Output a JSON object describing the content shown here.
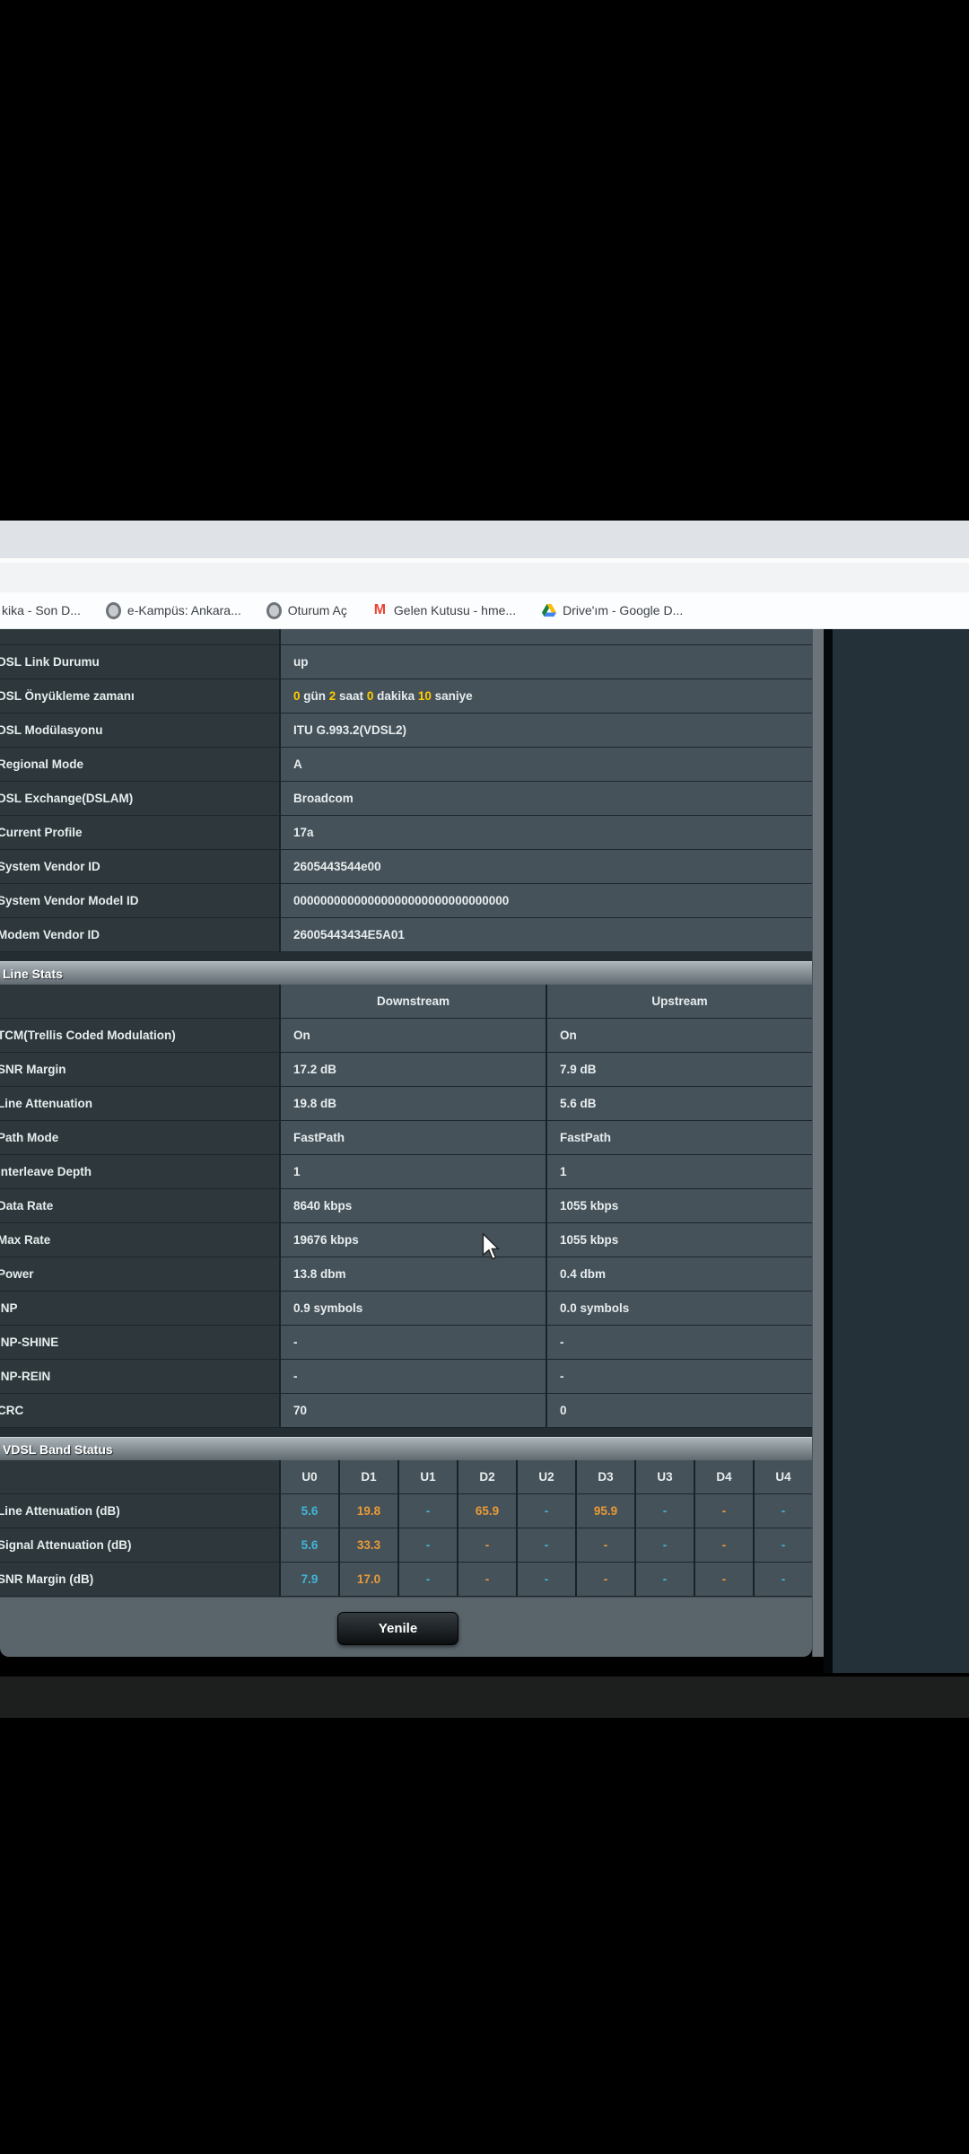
{
  "browser": {
    "bookmarks": [
      {
        "label": "kika - Son D...",
        "icon": "none"
      },
      {
        "label": "e-Kampüs: Ankara...",
        "icon": "globe"
      },
      {
        "label": "Oturum Aç",
        "icon": "globe"
      },
      {
        "label": "Gelen Kutusu - hme...",
        "icon": "gmail"
      },
      {
        "label": "Drive'ım - Google D...",
        "icon": "drive"
      }
    ]
  },
  "dsl_table": {
    "rows": [
      {
        "label": "DSL Link Durumu",
        "value": "up"
      },
      {
        "label": "DSL Önyükleme zamanı",
        "segments": [
          {
            "t": "0",
            "h": true
          },
          {
            "t": " gün ",
            "h": false
          },
          {
            "t": "2",
            "h": true
          },
          {
            "t": " saat ",
            "h": false
          },
          {
            "t": "0",
            "h": true
          },
          {
            "t": " dakika ",
            "h": false
          },
          {
            "t": "10",
            "h": true
          },
          {
            "t": " saniye",
            "h": false
          }
        ]
      },
      {
        "label": "DSL Modülasyonu",
        "value": "ITU G.993.2(VDSL2)"
      },
      {
        "label": "Regional Mode",
        "value": "A"
      },
      {
        "label": "DSL Exchange(DSLAM)",
        "value": "Broadcom"
      },
      {
        "label": "Current Profile",
        "value": "17a"
      },
      {
        "label": "System Vendor ID",
        "value": "2605443544e00"
      },
      {
        "label": "System Vendor Model ID",
        "value": "00000000000000000000000000000000"
      },
      {
        "label": "Modem Vendor ID",
        "value": "26005443434E5A01"
      }
    ]
  },
  "line_stats": {
    "title": "Line Stats",
    "columns": [
      "Downstream",
      "Upstream"
    ],
    "rows": [
      {
        "label": "TCM(Trellis Coded Modulation)",
        "down": "On",
        "up": "On"
      },
      {
        "label": "SNR Margin",
        "down": "17.2 dB",
        "up": "7.9 dB"
      },
      {
        "label": "Line Attenuation",
        "down": "19.8 dB",
        "up": "5.6 dB"
      },
      {
        "label": "Path Mode",
        "down": "FastPath",
        "up": "FastPath"
      },
      {
        "label": "Interleave Depth",
        "down": "1",
        "up": "1"
      },
      {
        "label": "Data Rate",
        "down": "8640 kbps",
        "up": "1055 kbps"
      },
      {
        "label": "Max Rate",
        "down": "19676 kbps",
        "up": "1055 kbps"
      },
      {
        "label": "Power",
        "down": "13.8 dbm",
        "up": "0.4 dbm"
      },
      {
        "label": "INP",
        "down": "0.9 symbols",
        "up": "0.0 symbols"
      },
      {
        "label": "INP-SHINE",
        "down": "-",
        "up": "-"
      },
      {
        "label": "INP-REIN",
        "down": "-",
        "up": "-"
      },
      {
        "label": "CRC",
        "down": "70",
        "up": "0"
      }
    ]
  },
  "band_status": {
    "title": "VDSL Band Status",
    "columns": [
      "U0",
      "D1",
      "U1",
      "D2",
      "U2",
      "D3",
      "U3",
      "D4",
      "U4"
    ],
    "column_types": [
      "u",
      "d",
      "u",
      "d",
      "u",
      "d",
      "u",
      "d",
      "u"
    ],
    "rows": [
      {
        "label": "Line Attenuation (dB)",
        "values": [
          "5.6",
          "19.8",
          "-",
          "65.9",
          "-",
          "95.9",
          "-",
          "-",
          "-"
        ]
      },
      {
        "label": "Signal Attenuation (dB)",
        "values": [
          "5.6",
          "33.3",
          "-",
          "-",
          "-",
          "-",
          "-",
          "-",
          "-"
        ]
      },
      {
        "label": "SNR Margin (dB)",
        "values": [
          "7.9",
          "17.0",
          "-",
          "-",
          "-",
          "-",
          "-",
          "-",
          "-"
        ]
      }
    ]
  },
  "actions": {
    "refresh_label": "Yenile"
  },
  "colors": {
    "upstream": "#3fb6d8",
    "downstream": "#e99a36",
    "highlight": "#ffcc00"
  }
}
